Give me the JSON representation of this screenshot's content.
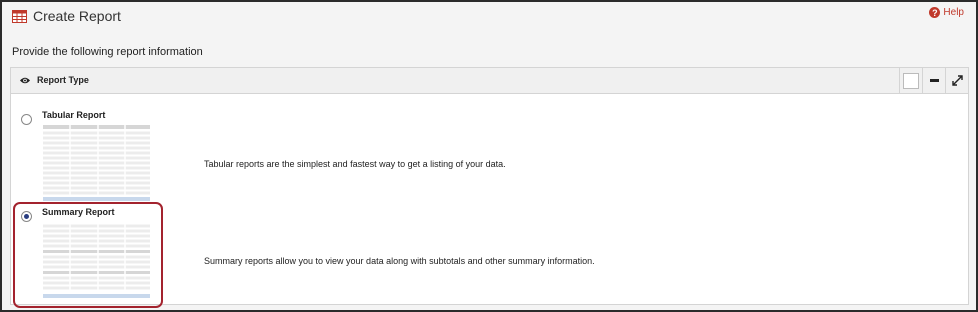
{
  "header": {
    "title": "Create Report",
    "help_label": "Help"
  },
  "subtitle": "Provide the following report information",
  "panel": {
    "title": "Report Type",
    "options": [
      {
        "label": "Tabular Report",
        "description": "Tabular reports are the simplest and fastest way to get a listing of your data.",
        "selected": false
      },
      {
        "label": "Summary Report",
        "description": "Summary reports allow you to view your data along with subtotals and other summary information.",
        "selected": true
      }
    ]
  },
  "colors": {
    "highlight": "#a3232e",
    "accent": "#c0392b",
    "thumbnail_footer": "#c8d8ec"
  },
  "icons": [
    "table-icon",
    "help-icon",
    "eye-icon",
    "minimize-icon",
    "expand-icon"
  ]
}
